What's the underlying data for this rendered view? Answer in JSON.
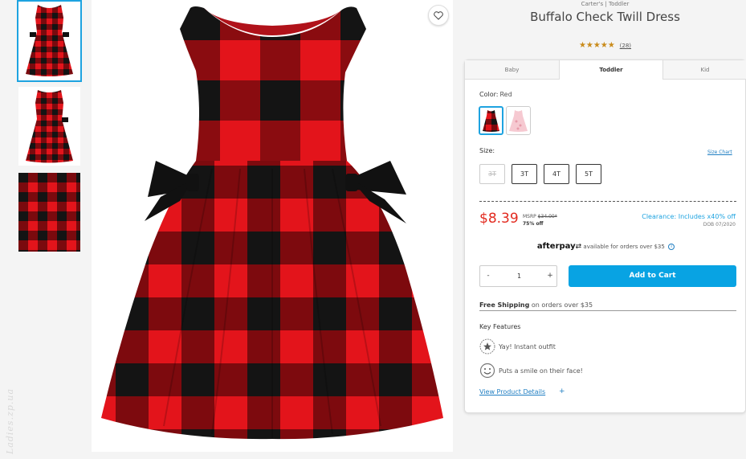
{
  "product": {
    "brand": "Carter's | Toddler",
    "title": "Buffalo Check Twill Dress",
    "stars": "★★★★★",
    "review_count": "(28)"
  },
  "tabs": [
    {
      "label": "Baby"
    },
    {
      "label": "Toddler"
    },
    {
      "label": "Kid"
    }
  ],
  "color": {
    "label": "Color:",
    "value": "Red",
    "swatches": [
      "red-buffalo-check",
      "pink-floral"
    ]
  },
  "size": {
    "label": "Size:",
    "chart_link": "Size Chart",
    "options": [
      "3T",
      "3T",
      "4T",
      "5T"
    ]
  },
  "pricing": {
    "price": "$8.39",
    "msrp_label": "MSRP",
    "msrp_value": "$34.00*",
    "discount": "75% off",
    "clearance": "Clearance: Includes x40% off",
    "dob": "DOB 07/2020"
  },
  "afterpay": {
    "logo": "afterpay",
    "text": "available for orders over $35"
  },
  "cart": {
    "minus": "-",
    "quantity": "1",
    "plus": "+",
    "add_label": "Add to Cart"
  },
  "shipping": {
    "bold": "Free Shipping",
    "text": "on orders over $35"
  },
  "features": {
    "title": "Key Features",
    "items": [
      "Yay! Instant outfit",
      "Puts a smile on their face!"
    ]
  },
  "details": {
    "link": "View Product Details",
    "plus": "+"
  },
  "watermark": "Ladies.zp.ua",
  "colors": {
    "accent": "#08a3e3",
    "price_red": "#e22a1f",
    "plaid_red": "#e3141b",
    "plaid_black": "#1a1a1a"
  }
}
